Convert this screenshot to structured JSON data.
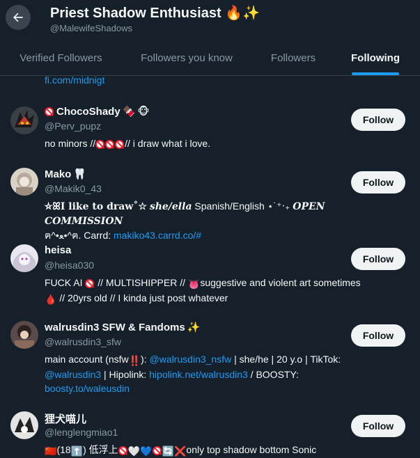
{
  "header": {
    "title": "Priest Shadow Enthusiast",
    "title_emojis": "🔥✨",
    "handle": "@MalewifeShadows"
  },
  "tabs": [
    {
      "label": "Verified Followers",
      "active": false
    },
    {
      "label": "Followers you know",
      "active": false
    },
    {
      "label": "Followers",
      "active": false
    },
    {
      "label": "Following",
      "active": true
    }
  ],
  "scrolled_link": "fi.com/midnigt",
  "follow_label": "Follow",
  "users": [
    {
      "name": "ChocoShady",
      "handle": "@Perv_pupz",
      "bio": {
        "p1": "no minors //",
        "p2": "// i draw what i love."
      }
    },
    {
      "name": "Mako",
      "handle": "@Makik0_43",
      "bio": {
        "p1": "☆ꕤI like to draw˚☆",
        "p2": "she/ella",
        "p3": "Spanish/English ⋆˙⁺‧₊",
        "p4": "OPEN COMMISSION",
        "p5": "ฅ^•ﻌ•^ฅ. Carrd:",
        "link": "makiko43.carrd.co/#"
      }
    },
    {
      "name": "heisa",
      "handle": "@heisa030",
      "bio": {
        "p1": "FUCK AI",
        "p2": "// MULTISHIPPER //",
        "p3": "suggestive and violent art sometimes",
        "p4": "// 20yrs old // I kinda just post whatever"
      }
    },
    {
      "name": "walrusdin3 SFW & Fandoms",
      "handle": "@walrusdin3_sfw",
      "bio": {
        "p1": "main account (nsfw",
        "p2": "):",
        "link1": "@walrusdin3_nsfw",
        "p3": " | she/he | 20 y.o | TikTok:",
        "link2": "@walrusdin3",
        "p4": " | Hipolink:",
        "link3": "hipolink.net/walrusdin3",
        "p5": " / BOOSTY:",
        "link4": "boosty.to/waleusdin"
      }
    },
    {
      "name": "狸犬喵儿",
      "handle": "@lenglengmiao1",
      "bio": {
        "p1": "(18",
        "p2": ")  低浮上",
        "p3": "only top shadow bottom Sonic"
      }
    }
  ],
  "colors": {
    "background": "#15202b",
    "accent": "#1d9bf0",
    "muted": "#8b98a5"
  }
}
